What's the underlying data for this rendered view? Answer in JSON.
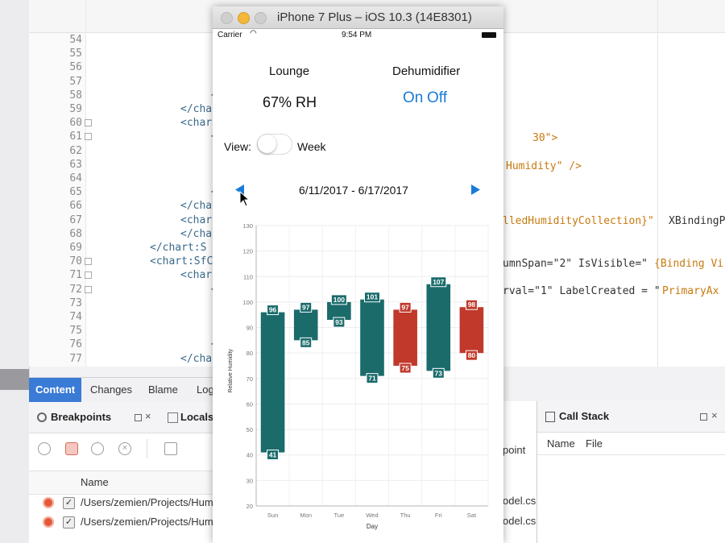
{
  "simulator": {
    "title": "iPhone 7 Plus – iOS 10.3 (14E8301)"
  },
  "status_bar": {
    "carrier": "Carrier",
    "time": "9:54 PM"
  },
  "app": {
    "room": "Lounge",
    "humidity": "67% RH",
    "device_label": "Dehumidifier",
    "device_on": "On",
    "device_off": "Off",
    "view_label": "View:",
    "view_mode": "Week",
    "date_range": "6/11/2017 - 6/17/2017"
  },
  "colors": {
    "accent": "#1a7bd8",
    "bar_normal": "#1b6b6b",
    "bar_high": "#c0392b"
  },
  "chart_data": {
    "type": "bar",
    "xlabel": "Day",
    "ylabel": "Relative Humidity",
    "ylim": [
      20,
      130
    ],
    "yticks": [
      "20",
      "30",
      "40",
      "50",
      "60",
      "70",
      "80",
      "90",
      "100",
      "110",
      "120",
      "130"
    ],
    "categories": [
      "Sun",
      "Mon",
      "Tue",
      "Wed",
      "Thu",
      "Fri",
      "Sat"
    ],
    "series": [
      {
        "low": [
          41,
          85,
          93,
          71,
          75,
          73,
          80
        ],
        "high": [
          96,
          97,
          100,
          101,
          97,
          107,
          98
        ]
      }
    ],
    "labels_high": [
      "96",
      "97",
      "100",
      "101",
      "97",
      "107",
      "98"
    ],
    "labels_low": [
      "41",
      "85",
      "93",
      "71",
      "75",
      "73",
      "80"
    ],
    "highlight": [
      "normal",
      "normal",
      "normal",
      "normal",
      "high",
      "normal",
      "high"
    ]
  },
  "ide": {
    "line_numbers": [
      "54",
      "55",
      "56",
      "57",
      "58",
      "59",
      "60",
      "61",
      "62",
      "63",
      "64",
      "65",
      "66",
      "67",
      "68",
      "69",
      "70",
      "71",
      "72",
      "73",
      "74",
      "75",
      "76",
      "77"
    ],
    "code_left": [
      "",
      "",
      "",
      "",
      "</",
      "</chart",
      "<chart",
      "<c",
      "",
      "",
      "",
      "</",
      "</chart",
      "<chart",
      "</chart",
      "</chart:S",
      "<chart:SfC",
      "<chart",
      "<c",
      "",
      "",
      "",
      "</",
      "</chart"
    ],
    "code_right": {
      "r61": "30\">",
      "r63": "Humidity\" />",
      "r67a": "lledHumidityCollection}\"",
      "r67b": "XBindingP",
      "r70a": "umnSpan=\"2\" IsVisible=\"",
      "r70b": "{Binding Vi",
      "r72a": "rval=\"1\" LabelCreated = \"",
      "r72b": "PrimaryAx"
    },
    "tabs": [
      "Content",
      "Changes",
      "Blame",
      "Log"
    ],
    "breakpoints_title": "Breakpoints",
    "locals_title": "Locals",
    "name_col": "Name",
    "bp_paths": [
      "/Users/zemien/Projects/Hum",
      "/Users/zemien/Projects/Hum"
    ],
    "bp_right_fragments": [
      "odel.cs:",
      "odel.cs:"
    ],
    "point_label": "point",
    "callstack": {
      "title": "Call Stack",
      "name_col": "Name",
      "file_col": "File"
    }
  }
}
